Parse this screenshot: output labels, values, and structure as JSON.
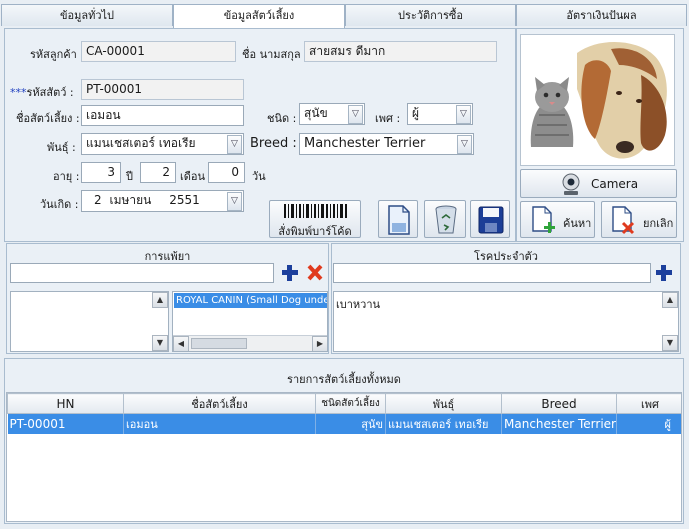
{
  "tabs": [
    {
      "label": "ข้อมูลทั่วไป"
    },
    {
      "label": "ข้อมูลสัตว์เลี้ยง"
    },
    {
      "label": "ประวัติการซื้อ"
    },
    {
      "label": "อัตราเงินปันผล"
    }
  ],
  "customer": {
    "code_label": "รหัสลูกค้า :",
    "code_value": "CA-00001",
    "name_label": "ชื่อ นามสกุล :",
    "name_value": "สายสมร ดีมาก"
  },
  "pet": {
    "id_required_mark": "***",
    "id_label": "รหัสสัตว์ :",
    "id_value": "PT-00001",
    "name_label": "ชื่อสัตว์เลี้ยง :",
    "name_value": "เอมอน",
    "type_label": "ชนิด :",
    "type_value": "สุนัข",
    "sex_label": "เพศ :",
    "sex_value": "ผู้",
    "breed_th_label": "พันธุ์ :",
    "breed_th_value": "แมนเชสเตอร์ เทอเรีย",
    "breed_en_label": "Breed :",
    "breed_en_value": "Manchester Terrier",
    "age_label": "อายุ :",
    "age_years": "3",
    "years_unit": "ปี",
    "age_months": "2",
    "months_unit": "เดือน",
    "age_days": "0",
    "days_unit": "วัน",
    "birth_label": "วันเกิด :",
    "birth_day": "2",
    "birth_month": "เมษายน",
    "birth_year": "2551"
  },
  "buttons": {
    "print_barcode": "สั่งพิมพ์บาร์โค้ด",
    "camera": "Camera",
    "search": "ค้นหา",
    "cancel": "ยกเลิก"
  },
  "allergy": {
    "title": "การแพ้ยา",
    "input_value": "",
    "items": [],
    "product_items": [
      "ROYAL CANIN (Small Dog unde"
    ]
  },
  "disease": {
    "title": "โรคประจำตัว",
    "input_value": "",
    "items": [
      "เบาหวาน"
    ]
  },
  "pet_list": {
    "title": "รายการสัตว์เลี้ยงทั้งหมด",
    "columns": [
      "HN",
      "ชื่อสัตว์เลี้ยง",
      "ชนิดสัตว์เลี้ยง",
      "พันธุ์",
      "Breed",
      "เพศ"
    ],
    "rows": [
      [
        "PT-00001",
        "เอมอน",
        "สุนัข",
        "แมนเชสเตอร์ เทอเรีย",
        "Manchester Terrier",
        "ผู้"
      ]
    ]
  },
  "colors": {
    "selection": "#3a8de6",
    "delete_red": "#e03a1e",
    "add_blue": "#1c3f9c"
  },
  "icons": {
    "camera": "webcam-icon",
    "search": "document-add-icon",
    "cancel": "document-delete-icon",
    "save": "floppy-disk-icon"
  }
}
